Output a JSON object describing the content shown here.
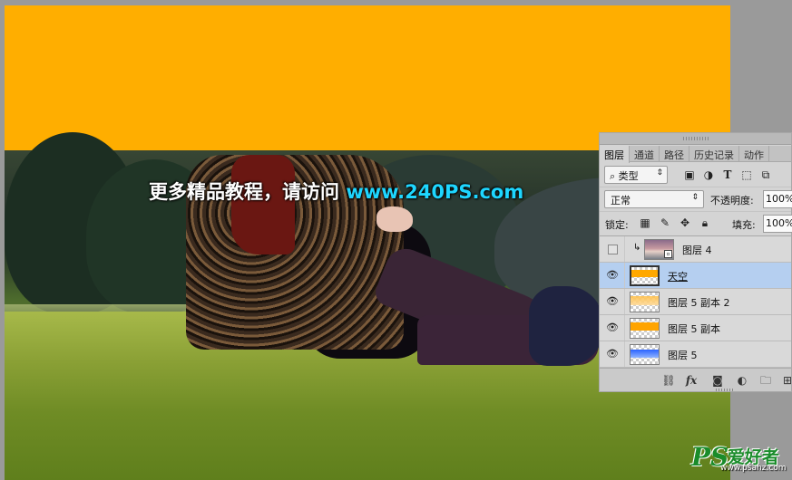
{
  "canvas": {
    "watermark_cn": "更多精品教程，请访问",
    "watermark_url": "www.240PS.com",
    "sky_color": "#ffae00"
  },
  "layers_panel": {
    "tabs": [
      {
        "label": "图层",
        "active": true
      },
      {
        "label": "通道",
        "active": false
      },
      {
        "label": "路径",
        "active": false
      },
      {
        "label": "历史记录",
        "active": false
      },
      {
        "label": "动作",
        "active": false
      }
    ],
    "filter": {
      "label": "类型",
      "search_icon": "search-icon"
    },
    "filter_icons": [
      "image-filter-icon",
      "adjustment-filter-icon",
      "type-filter-icon",
      "shape-filter-icon",
      "smart-object-filter-icon"
    ],
    "blend_mode": "正常",
    "opacity_label": "不透明度:",
    "opacity_value": "100%",
    "lock_label": "锁定:",
    "lock_icons": [
      "lock-transparent-icon",
      "lock-pixels-icon",
      "lock-position-icon",
      "lock-all-icon"
    ],
    "fill_label": "填充:",
    "fill_value": "100%",
    "layers": [
      {
        "name": "图层 4",
        "visible": false,
        "clipped": true,
        "smart_object": true,
        "thumb": "photo"
      },
      {
        "name": "天空",
        "visible": true,
        "selected": true,
        "thumb": "orange"
      },
      {
        "name": "图层 5 副本 2",
        "visible": true,
        "thumb": "orange-light"
      },
      {
        "name": "图层 5 副本",
        "visible": true,
        "thumb": "orange"
      },
      {
        "name": "图层 5",
        "visible": true,
        "thumb": "blue"
      }
    ],
    "footer_icons": [
      "link-layers-icon",
      "fx-icon",
      "add-mask-icon",
      "adjustment-layer-icon",
      "new-group-icon",
      "new-layer-icon"
    ],
    "fx_label": "fx"
  },
  "site_logo": {
    "ps": "PS",
    "cn": "爱好者",
    "url": "www.psahz.com"
  }
}
